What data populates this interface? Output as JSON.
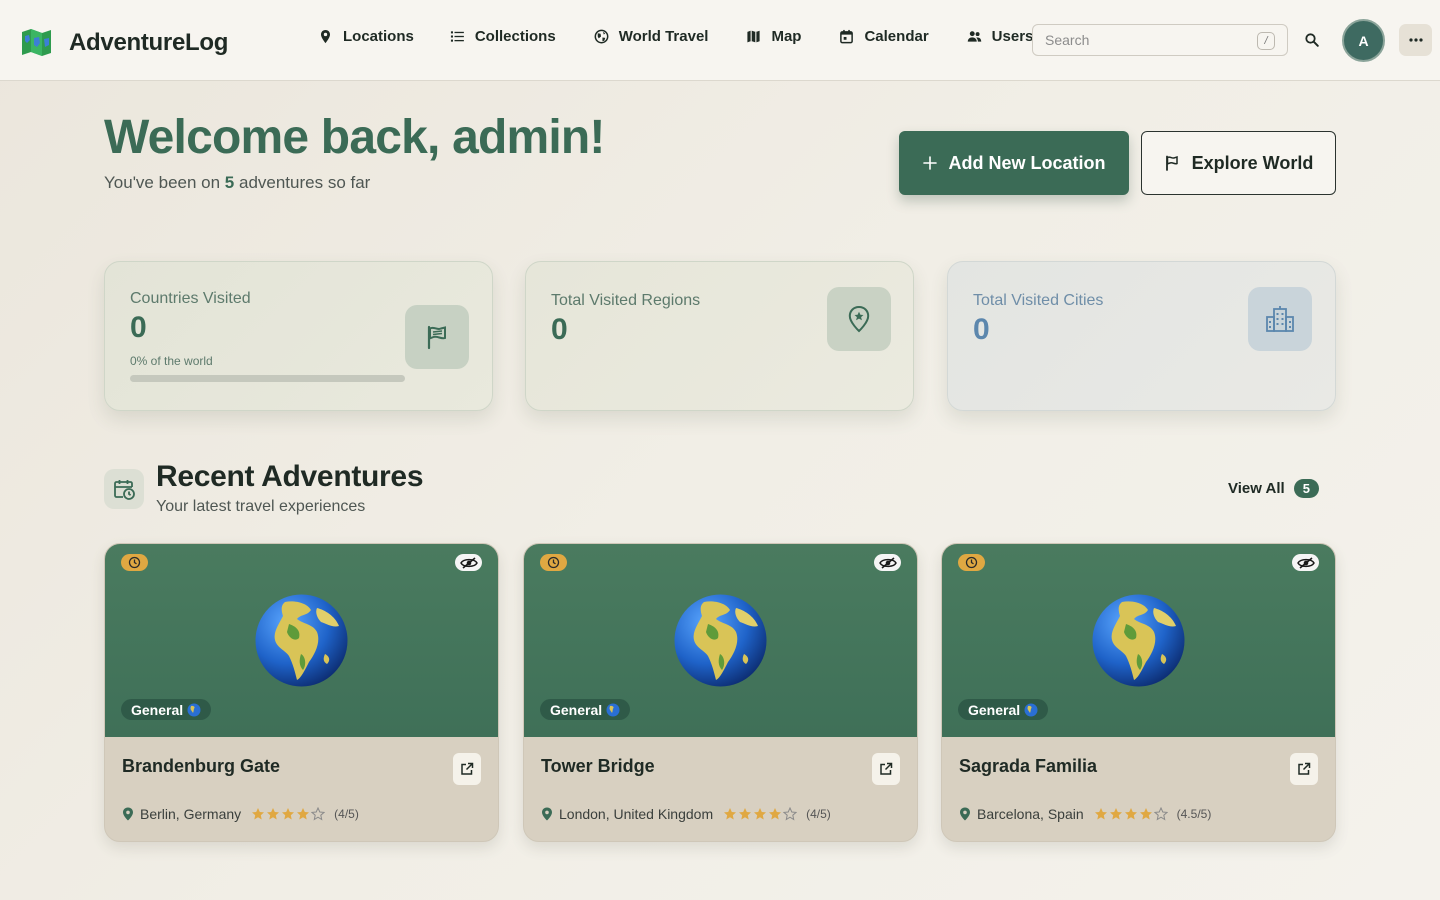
{
  "brand": {
    "name": "AdventureLog"
  },
  "nav": {
    "items": [
      {
        "label": "Locations",
        "icon": "map-pin-icon"
      },
      {
        "label": "Collections",
        "icon": "list-icon"
      },
      {
        "label": "World Travel",
        "icon": "globe-icon"
      },
      {
        "label": "Map",
        "icon": "map-icon"
      },
      {
        "label": "Calendar",
        "icon": "calendar-icon"
      },
      {
        "label": "Users",
        "icon": "users-icon"
      }
    ],
    "search_placeholder": "Search",
    "search_shortcut": "/",
    "avatar_initial": "A"
  },
  "hero": {
    "title": "Welcome back, admin!",
    "sub_prefix": "You've been on ",
    "adventure_count": "5",
    "sub_suffix": " adventures so far",
    "add_button": "Add New Location",
    "explore_button": "Explore World"
  },
  "stats": [
    {
      "label": "Countries Visited",
      "value": "0",
      "note": "0% of the world",
      "progress": 0,
      "icon": "flag-icon"
    },
    {
      "label": "Total Visited Regions",
      "value": "0",
      "icon": "map-pin-star-icon"
    },
    {
      "label": "Total Visited Cities",
      "value": "0",
      "icon": "city-icon"
    }
  ],
  "recent": {
    "title": "Recent Adventures",
    "subtitle": "Your latest travel experiences",
    "view_all": "View All",
    "count": "5",
    "cards": [
      {
        "title": "Brandenburg Gate",
        "category": "General",
        "location": "Berlin, Germany",
        "stars": 4,
        "rating": "(4/5)"
      },
      {
        "title": "Tower Bridge",
        "category": "General",
        "location": "London, United Kingdom",
        "stars": 4,
        "rating": "(4/5)"
      },
      {
        "title": "Sagrada Familia",
        "category": "General",
        "location": "Barcelona, Spain",
        "stars": 4,
        "rating": "(4.5/5)"
      }
    ]
  },
  "colors": {
    "primary": "#3b6b56",
    "card_header": "#4a7b5f",
    "star": "#e0a842",
    "cities_accent": "#5c87ad"
  }
}
